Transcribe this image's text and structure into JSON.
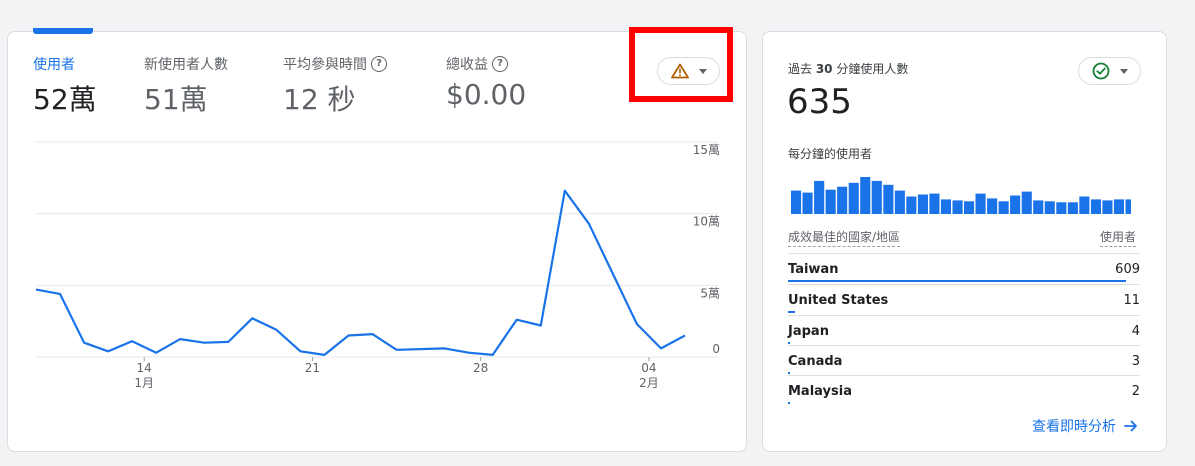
{
  "overview": {
    "metrics": [
      {
        "label": "使用者",
        "value": "52萬",
        "active": true,
        "help": false
      },
      {
        "label": "新使用者人數",
        "value": "51萬",
        "active": false,
        "help": false
      },
      {
        "label": "平均參與時間",
        "value": "12 秒",
        "active": false,
        "help": true
      },
      {
        "label": "總收益",
        "value": "$0.00",
        "active": false,
        "help": true
      }
    ],
    "warning_icon": "warning-triangle-icon",
    "colors": {
      "accent": "#1a73e8",
      "warning": "#b06000",
      "highlight": "#ff0000"
    }
  },
  "chart_data": {
    "type": "line",
    "series": [
      {
        "values": [
          47000,
          44000,
          10000,
          4000,
          11000,
          3000,
          12500,
          10000,
          10500,
          27000,
          19000,
          4000,
          1500,
          15000,
          16000,
          5000,
          5500,
          6000,
          3000,
          1500,
          26000,
          22000,
          116000,
          93000,
          58000,
          23000,
          6000,
          15000
        ]
      }
    ],
    "x_ticks": [
      {
        "index": 4.5,
        "day": "14",
        "month": "1月"
      },
      {
        "index": 11.5,
        "day": "21",
        "month": ""
      },
      {
        "index": 18.5,
        "day": "28",
        "month": ""
      },
      {
        "index": 25.5,
        "day": "04",
        "month": "2月"
      }
    ],
    "y_ticks": [
      {
        "value": 0,
        "label": "0"
      },
      {
        "value": 50000,
        "label": "5萬"
      },
      {
        "value": 100000,
        "label": "10萬"
      },
      {
        "value": 150000,
        "label": "15萬"
      }
    ],
    "ylim": [
      0,
      150000
    ],
    "grid": true,
    "color": "#1a73e8"
  },
  "realtime": {
    "title_prefix": "過去 ",
    "title_number": "30",
    "title_suffix": " 分鐘使用人數",
    "total": "635",
    "per_minute_label": "每分鐘的使用者",
    "per_minute": [
      24,
      22,
      34,
      25,
      28,
      32,
      38,
      34,
      30,
      24,
      18,
      20,
      21,
      15,
      14,
      13,
      21,
      16,
      13,
      19,
      23,
      14,
      13,
      12,
      12,
      18,
      15,
      14,
      15,
      15
    ],
    "table_head_left": "成效最佳的國家/地區",
    "table_head_right": "使用者",
    "countries": [
      {
        "name": "Taiwan",
        "users": "609",
        "share": 0.96
      },
      {
        "name": "United States",
        "users": "11",
        "share": 0.02
      },
      {
        "name": "Japan",
        "users": "4",
        "share": 0.007
      },
      {
        "name": "Canada",
        "users": "3",
        "share": 0.005
      },
      {
        "name": "Malaysia",
        "users": "2",
        "share": 0.003
      }
    ],
    "link_label": "查看即時分析",
    "status_icon": "check-circle-icon",
    "colors": {
      "check": "#188038"
    }
  }
}
